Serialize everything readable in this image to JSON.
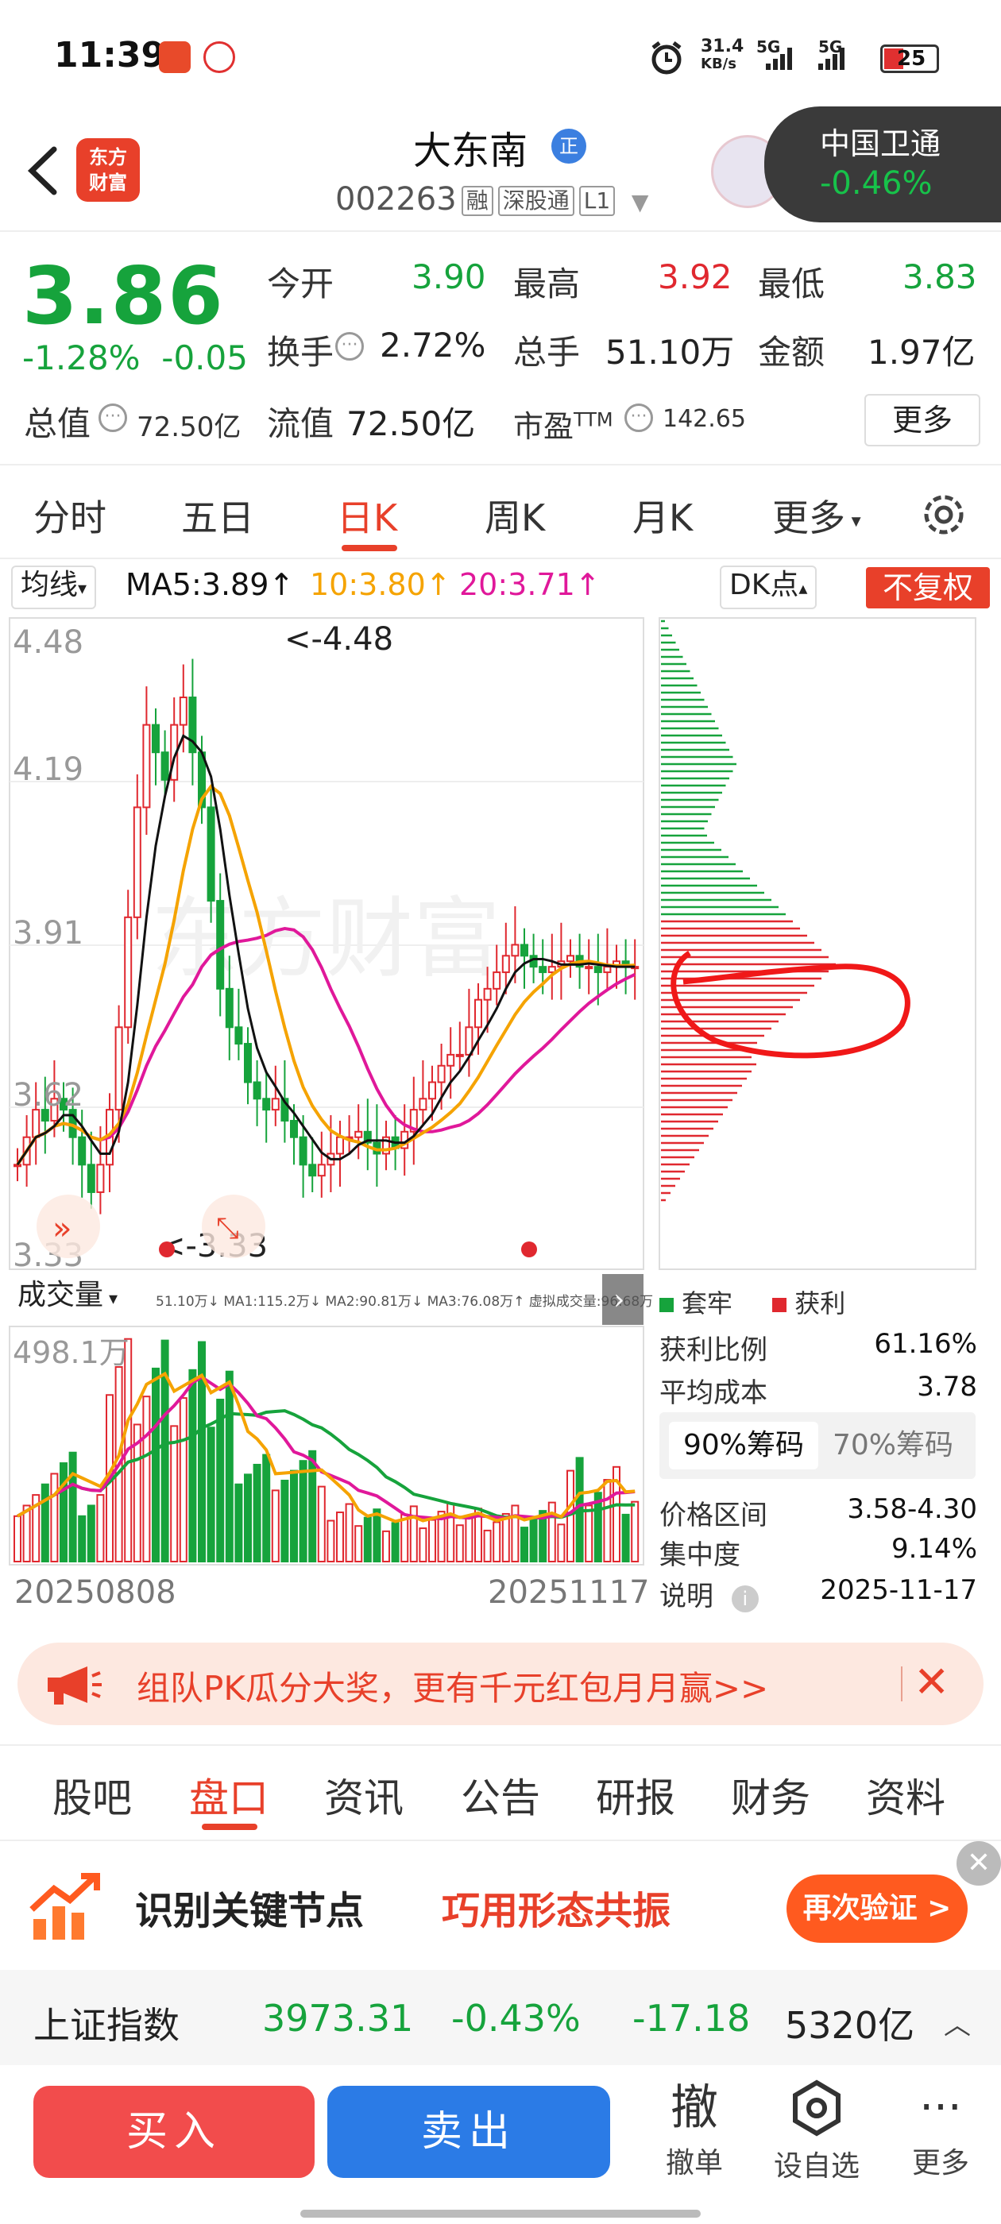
{
  "status_bar": {
    "time": "11:39",
    "net_speed_value": "31.4",
    "net_speed_unit": "KB/s",
    "signal1": "5G",
    "signal2": "5G",
    "battery": "25"
  },
  "header": {
    "stock_name": "大东南",
    "badge": "正",
    "stock_code": "002263",
    "tags": [
      "融",
      "深股通",
      "L1"
    ],
    "logo_line1": "东方",
    "logo_line2": "财富",
    "related_name": "中国卫通",
    "related_change": "-0.46%"
  },
  "quote": {
    "price": "3.86",
    "change_pct": "-1.28%",
    "change_abs": "-0.05",
    "open_label": "今开",
    "open": "3.90",
    "high_label": "最高",
    "high": "3.92",
    "low_label": "最低",
    "low": "3.83",
    "turnover_label": "换手",
    "turnover": "2.72%",
    "volume_label": "总手",
    "volume": "51.10万",
    "amount_label": "金额",
    "amount": "1.97亿",
    "mktcap_label": "总值",
    "mktcap": "72.50亿",
    "float_label": "流值",
    "float": "72.50亿",
    "pe_label": "市盈",
    "pe_sup": "TTM",
    "pe": "142.65",
    "more": "更多"
  },
  "period_tabs": [
    "分时",
    "五日",
    "日K",
    "周K",
    "月K",
    "更多"
  ],
  "active_period": "日K",
  "ma": {
    "select": "均线",
    "ma5": "MA5:3.89↑",
    "ma10": "10:3.80↑",
    "ma20": "20:3.71↑",
    "dk": "DK点",
    "fq": "不复权",
    "color_ma5": "#111111",
    "color_ma10": "#f5a300",
    "color_ma20": "#e0189a"
  },
  "kline": {
    "y_labels": [
      "4.48",
      "4.19",
      "3.91",
      "3.62",
      "3.33"
    ],
    "max_label": "<-4.48",
    "min_label": "<-3.33",
    "watermark": "东方财富"
  },
  "volume_panel": {
    "select": "成交量",
    "legend": "51.10万↓ MA1:115.2万↓ MA2:90.81万↓ MA3:76.08万↑ 虚拟成交量:96.68万",
    "max_label": "498.1万",
    "date_start": "20250808",
    "date_end": "20251117"
  },
  "chip": {
    "legend_trap": "套牢",
    "legend_profit": "获利",
    "profit_ratio_label": "获利比例",
    "profit_ratio": "61.16%",
    "avg_cost_label": "平均成本",
    "avg_cost": "3.78",
    "tab90": "90%筹码",
    "tab70": "70%筹码",
    "range_label": "价格区间",
    "range": "3.58-4.30",
    "concentration_label": "集中度",
    "concentration": "9.14%",
    "note_label": "说明",
    "date": "2025-11-17"
  },
  "promo": {
    "text": "组队PK瓜分大奖，更有千元红包月月赢>>"
  },
  "bottom_tabs": [
    "股吧",
    "盘口",
    "资讯",
    "公告",
    "研报",
    "财务",
    "资料"
  ],
  "active_bottom_tab": "盘口",
  "ad": {
    "title": "识别关键节点",
    "title2": "巧用形态共振",
    "button": "再次验证 >"
  },
  "index": {
    "name": "上证指数",
    "value": "3973.31",
    "pct": "-0.43%",
    "chg": "-17.18",
    "amount": "5320亿"
  },
  "toolbar": {
    "buy": "买入",
    "sell": "卖出",
    "cancel_icon": "撤",
    "cancel": "撤单",
    "watch": "设自选",
    "more": "更多"
  }
}
